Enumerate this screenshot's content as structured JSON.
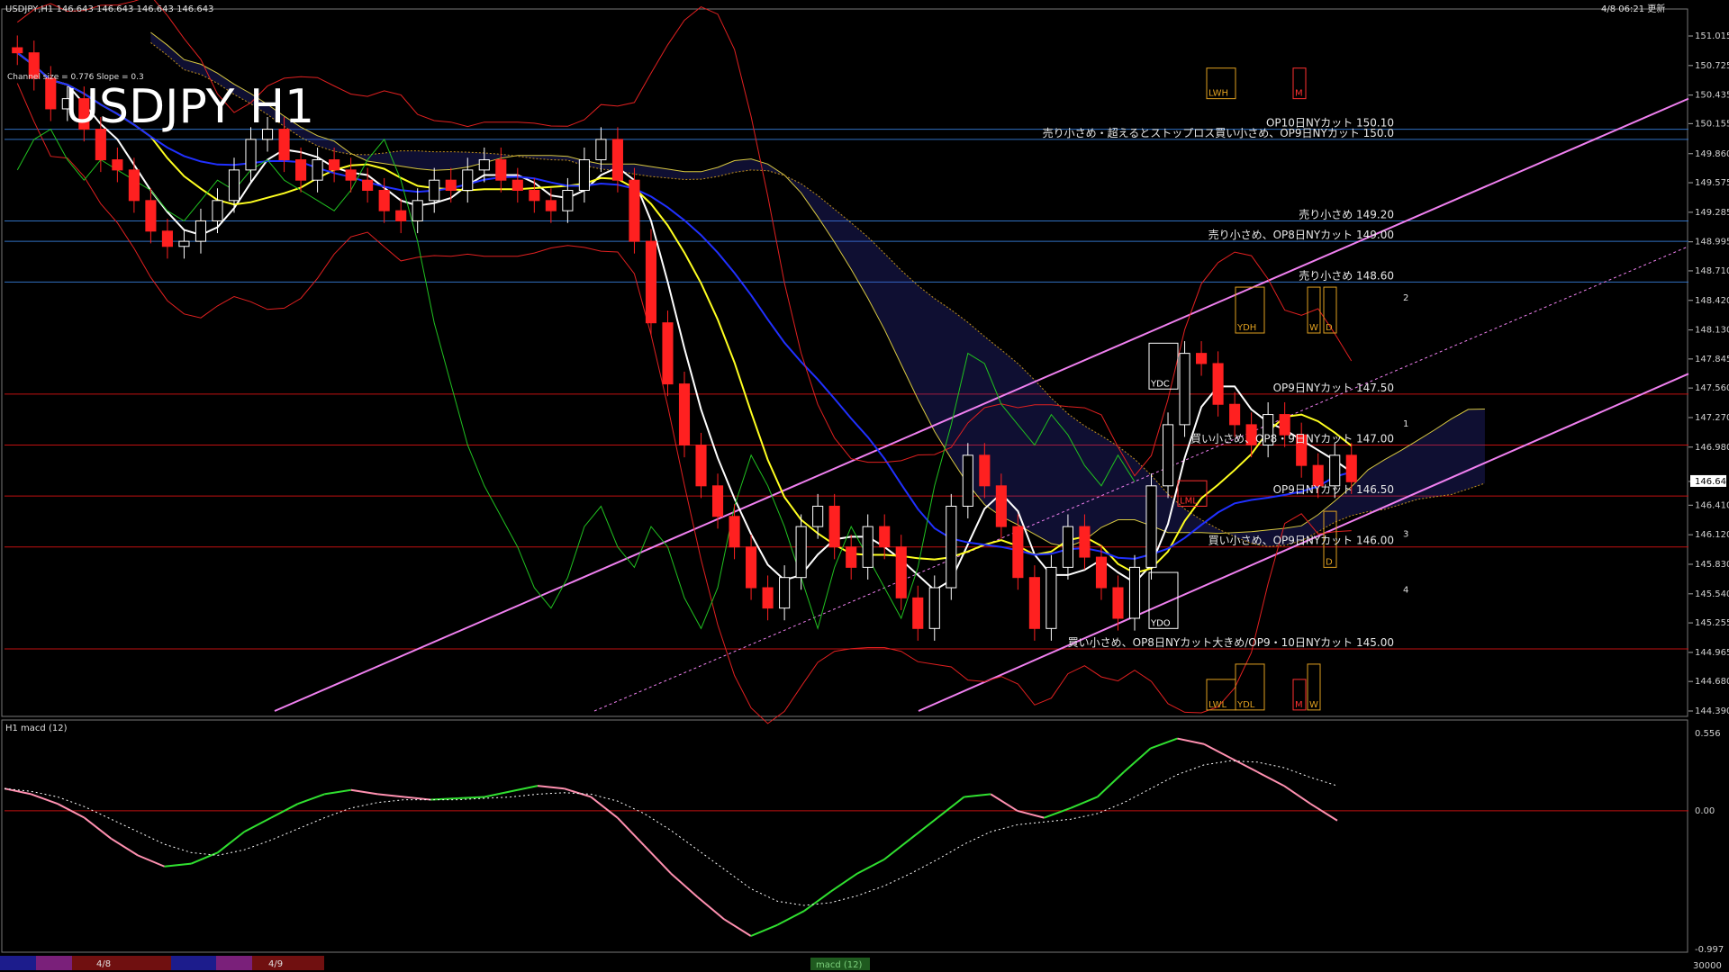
{
  "header": {
    "symbol_info": "USDJPY,H1 146.643 146.643 146.643 146.643",
    "timestamp": "4/8 06:21 更新",
    "channel_info": "Channel size = 0.776 Slope = 0.3",
    "main_title": "USDJPY H1",
    "macd_title": "H1  macd (12)"
  },
  "colors": {
    "background": "#000000",
    "bull_candle": "#ffffff",
    "bear_candle": "#ff2020",
    "ma_fast": "#ffffff",
    "ma_mid": "#ffff20",
    "ma_slow": "#2030ff",
    "chikou": "#20c020",
    "bollinger": "#e02020",
    "cloud_span": "#d8c840",
    "channel": "#f080f0",
    "macd_up": "#30e030",
    "macd_down": "#ff90b0",
    "level_red": "#c01010",
    "level_blue": "#3070c0"
  },
  "levels": [
    {
      "text": "OP10日NYカット 150.10",
      "price": 150.1,
      "color": "#3070c0"
    },
    {
      "text": "売り小さめ・超えるとストップロス買い小さめ、OP9日NYカット 150.0",
      "price": 150.0,
      "color": "#3070c0"
    },
    {
      "text": "売り小さめ 149.20",
      "price": 149.2,
      "color": "#3070c0"
    },
    {
      "text": "売り小さめ、OP8日NYカット 149.00",
      "price": 149.0,
      "color": "#3070c0"
    },
    {
      "text": "売り小さめ 148.60",
      "price": 148.6,
      "color": "#3070c0"
    },
    {
      "text": "OP9日NYカット 147.50",
      "price": 147.5,
      "color": "#c01010"
    },
    {
      "text": "買い小さめ、OP8・9日NYカット 147.00",
      "price": 147.0,
      "color": "#c01010"
    },
    {
      "text": "OP9日NYカット 146.50",
      "price": 146.5,
      "color": "#c01010"
    },
    {
      "text": "買い小さめ、OP9日NYカット 146.00",
      "price": 146.0,
      "color": "#c01010"
    },
    {
      "text": "買い小さめ、OP8日NYカット大きめ/OP9・10日NYカット 145.00",
      "price": 145.0,
      "color": "#c01010"
    }
  ],
  "box_labels": [
    {
      "text": "LWH",
      "color": "#e0a020"
    },
    {
      "text": "M",
      "color": "#ff3030"
    },
    {
      "text": "YDH",
      "color": "#e0a020"
    },
    {
      "text": "W",
      "color": "#e0a020"
    },
    {
      "text": "D",
      "color": "#e0a020"
    },
    {
      "text": "YDC",
      "color": "#ffffff"
    },
    {
      "text": "LML",
      "color": "#ff3030"
    },
    {
      "text": "D",
      "color": "#e0a020"
    },
    {
      "text": "YDO",
      "color": "#ffffff"
    },
    {
      "text": "YDL",
      "color": "#e0a020"
    },
    {
      "text": "W",
      "color": "#e0a020"
    },
    {
      "text": "LWL",
      "color": "#e0a020"
    },
    {
      "text": "M",
      "color": "#ff3030"
    }
  ],
  "projection_labels": [
    "1",
    "2",
    "3",
    "4"
  ],
  "bottom_bar": {
    "date_labels": [
      "4/8",
      "4/9"
    ],
    "indicator_tab": "macd (12)",
    "macd_scale_bottom": "30000"
  },
  "chart_data": {
    "type": "line",
    "title": "USDJPY H1",
    "ylim": [
      144.39,
      151.015
    ],
    "y_ticks": [
      "151.015",
      "150.725",
      "150.435",
      "150.155",
      "149.860",
      "149.575",
      "149.285",
      "148.995",
      "148.710",
      "148.420",
      "148.130",
      "147.845",
      "147.560",
      "147.270",
      "146.980",
      "146.643",
      "146.410",
      "146.120",
      "145.830",
      "145.540",
      "145.255",
      "144.965",
      "144.680",
      "144.390"
    ],
    "current_price": "146.643",
    "close": [
      150.85,
      150.6,
      150.3,
      150.4,
      150.1,
      149.8,
      149.7,
      149.4,
      149.1,
      148.95,
      149.0,
      149.2,
      149.4,
      149.7,
      150.0,
      150.1,
      149.8,
      149.6,
      149.8,
      149.7,
      149.6,
      149.5,
      149.3,
      149.2,
      149.4,
      149.6,
      149.5,
      149.7,
      149.8,
      149.6,
      149.5,
      149.4,
      149.3,
      149.5,
      149.8,
      150.0,
      149.6,
      149.0,
      148.2,
      147.6,
      147.0,
      146.6,
      146.3,
      146.0,
      145.6,
      145.4,
      145.7,
      146.2,
      146.4,
      146.0,
      145.8,
      146.2,
      146.0,
      145.5,
      145.2,
      145.6,
      146.4,
      146.9,
      146.6,
      146.2,
      145.7,
      145.2,
      145.8,
      146.2,
      145.9,
      145.6,
      145.3,
      145.8,
      146.6,
      147.2,
      147.9,
      147.8,
      147.4,
      147.2,
      147.0,
      147.3,
      147.1,
      146.8,
      146.6,
      146.9,
      146.64
    ],
    "macd": {
      "ylim": [
        -0.997,
        0.556
      ],
      "y_ticks": [
        "0.556",
        "0.00",
        "-0.997"
      ],
      "main": [
        0.16,
        0.12,
        0.05,
        -0.05,
        -0.2,
        -0.32,
        -0.4,
        -0.38,
        -0.3,
        -0.15,
        -0.05,
        0.05,
        0.12,
        0.15,
        0.12,
        0.1,
        0.08,
        0.09,
        0.1,
        0.14,
        0.18,
        0.16,
        0.1,
        -0.05,
        -0.25,
        -0.45,
        -0.62,
        -0.78,
        -0.9,
        -0.82,
        -0.72,
        -0.58,
        -0.45,
        -0.35,
        -0.2,
        -0.05,
        0.1,
        0.12,
        0.0,
        -0.05,
        0.02,
        0.1,
        0.28,
        0.45,
        0.52,
        0.48,
        0.38,
        0.28,
        0.18,
        0.05,
        -0.07
      ],
      "signal": [
        0.16,
        0.14,
        0.1,
        0.03,
        -0.06,
        -0.15,
        -0.24,
        -0.3,
        -0.32,
        -0.28,
        -0.21,
        -0.13,
        -0.05,
        0.02,
        0.06,
        0.08,
        0.08,
        0.08,
        0.09,
        0.1,
        0.12,
        0.13,
        0.12,
        0.07,
        -0.02,
        -0.14,
        -0.28,
        -0.42,
        -0.56,
        -0.65,
        -0.68,
        -0.66,
        -0.61,
        -0.54,
        -0.45,
        -0.35,
        -0.24,
        -0.15,
        -0.1,
        -0.08,
        -0.06,
        -0.02,
        0.06,
        0.16,
        0.26,
        0.33,
        0.36,
        0.35,
        0.31,
        0.24,
        0.18
      ]
    }
  }
}
